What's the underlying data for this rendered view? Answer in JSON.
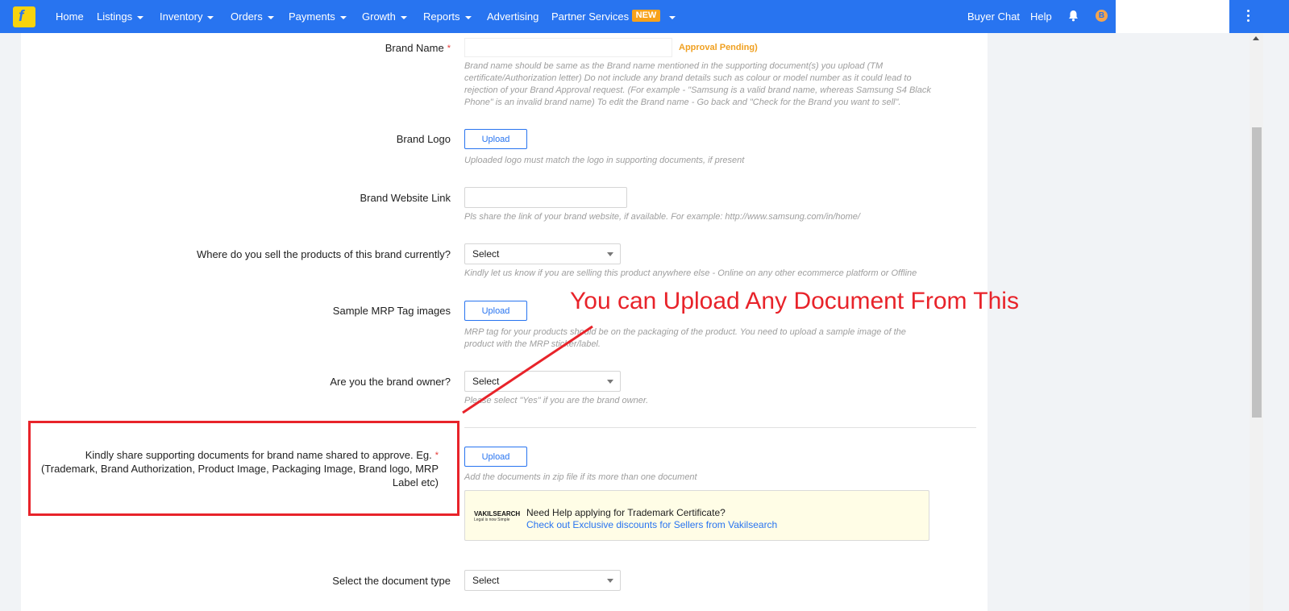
{
  "nav": {
    "items": [
      {
        "label": "Home",
        "has_caret": false
      },
      {
        "label": "Listings",
        "has_caret": true
      },
      {
        "label": "Inventory",
        "has_caret": true
      },
      {
        "label": "Orders",
        "has_caret": true
      },
      {
        "label": "Payments",
        "has_caret": true
      },
      {
        "label": "Growth",
        "has_caret": true
      },
      {
        "label": "Reports",
        "has_caret": true
      },
      {
        "label": "Advertising",
        "has_caret": false
      },
      {
        "label": "Partner Services",
        "has_caret": false
      }
    ],
    "new_badge": "NEW",
    "buyer_chat": "Buyer Chat",
    "help": "Help",
    "account_initial": "B",
    "icons": [
      "flipkart-logo-icon",
      "bell-icon",
      "kebab-menu-icon"
    ]
  },
  "form": {
    "brand_name": {
      "label": "Brand Name",
      "status": "Approval Pending)",
      "hint": "Brand name should be same as the Brand name mentioned in the supporting document(s) you upload (TM certificate/Authorization letter) Do not include any brand details such as colour or model number as it could lead to rejection of your Brand Approval request. (For example - \"Samsung is a valid brand name, whereas Samsung S4 Black Phone\" is an invalid brand name) To edit the Brand name - Go back and \"Check for the Brand you want to sell\"."
    },
    "brand_logo": {
      "label": "Brand Logo",
      "button": "Upload",
      "hint": "Uploaded logo must match the logo in supporting documents, if present"
    },
    "website": {
      "label": "Brand Website Link",
      "value": "",
      "hint": "Pls share the link of your brand website, if available. For example: http://www.samsung.com/in/home/"
    },
    "sell_where": {
      "label": "Where do you sell the products of this brand currently?",
      "selected": "Select",
      "hint": "Kindly let us know if you are selling this product anywhere else - Online on any other ecommerce platform or Offline"
    },
    "mrp": {
      "label": "Sample MRP Tag images",
      "button": "Upload",
      "hint_line1": "MRP tag for your products should be on the packaging of the product. You need to upload a sample image of the",
      "hint_line2": "product with the MRP sticker/label."
    },
    "owner": {
      "label": "Are you the brand owner?",
      "selected": "Select",
      "hint": "Please select \"Yes\" if you are the brand owner."
    },
    "supporting_docs": {
      "label_line1": "Kindly share supporting documents for brand name shared to approve. Eg.",
      "label_line2": "(Trademark, Brand Authorization, Product Image, Packaging Image, Brand logo, MRP",
      "label_line3": "Label etc)",
      "button": "Upload",
      "hint": "Add the documents in zip file if its more than one document"
    },
    "promo": {
      "logo_text": "VAKILSEARCH",
      "logo_tagline": "Legal is now Simple",
      "title": "Need Help applying for Trademark Certificate?",
      "link": "Check out Exclusive discounts for Sellers from Vakilsearch"
    },
    "doc_type": {
      "label": "Select the document type",
      "selected": "Select"
    },
    "required_mark": "*"
  },
  "annotation": {
    "text": "You can Upload Any Document From This",
    "color": "#e8232a"
  },
  "colors": {
    "brand_blue": "#2874f0",
    "badge_orange": "#f7a21b",
    "warning": "#f0a020"
  }
}
